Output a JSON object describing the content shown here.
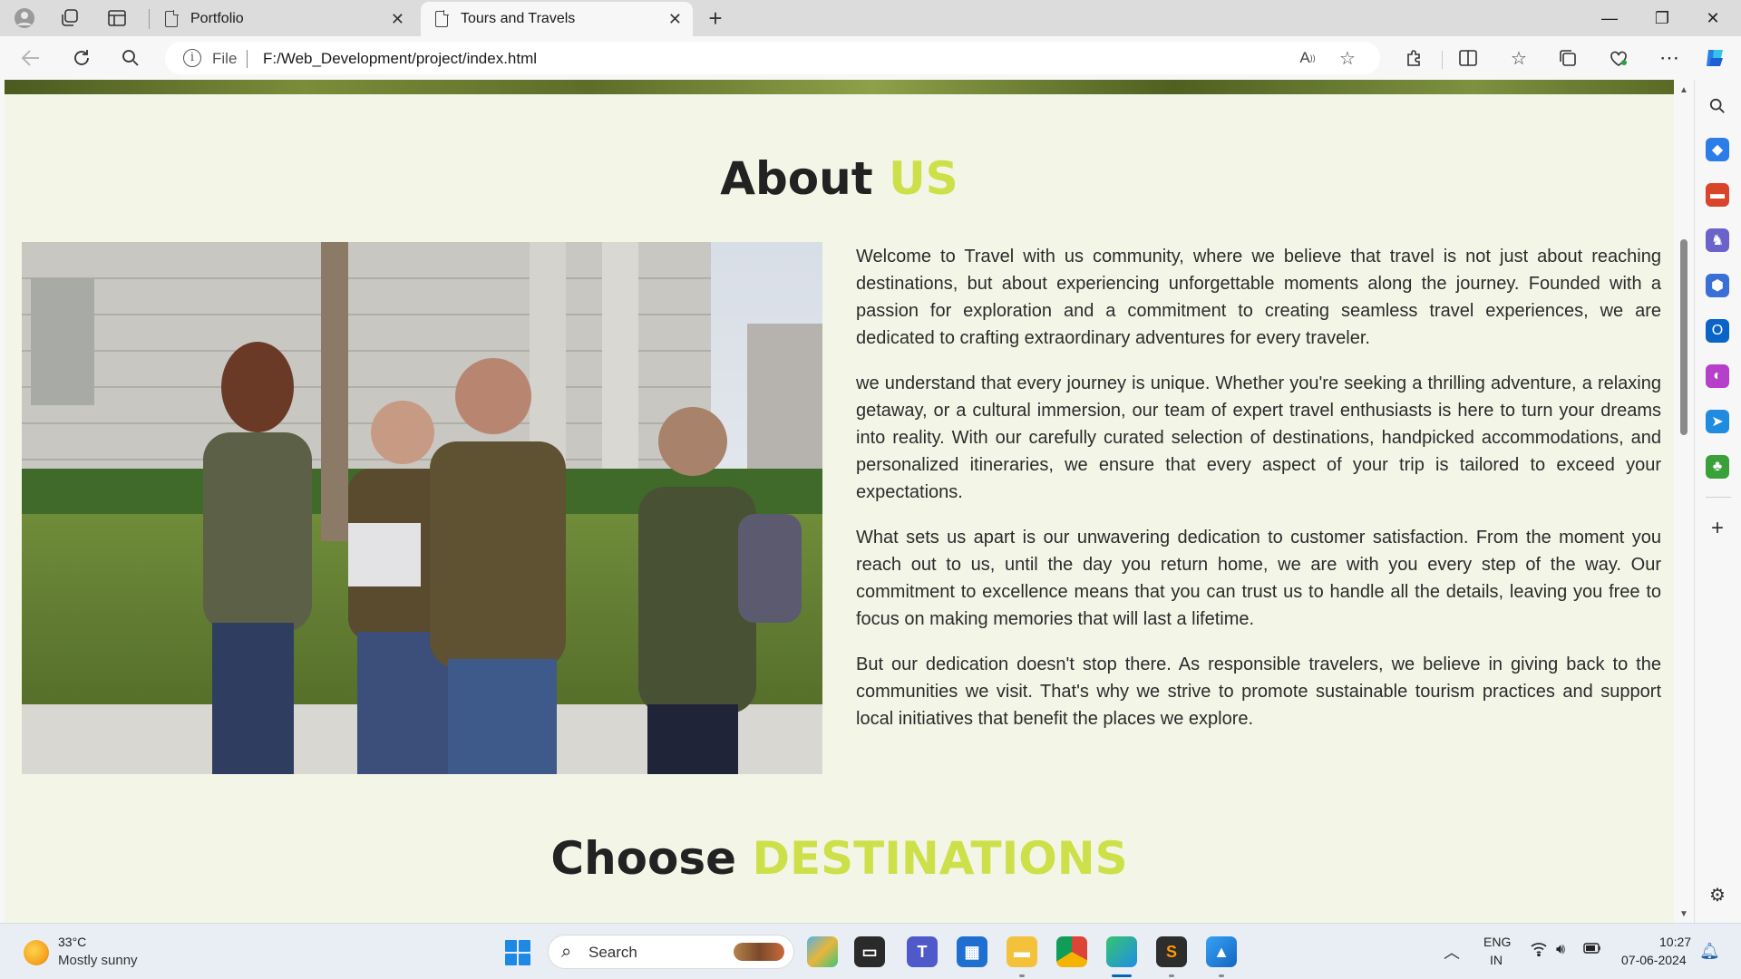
{
  "browser": {
    "tabs": [
      {
        "title": "Portfolio",
        "close": "✕"
      },
      {
        "title": "Tours and Travels",
        "close": "✕"
      }
    ],
    "new_tab": "+",
    "window_controls": {
      "minimize": "—",
      "restore": "❐",
      "close": "✕"
    },
    "address": {
      "scheme_label": "File",
      "url": "F:/Web_Development/project/index.html"
    }
  },
  "page": {
    "about_title": {
      "main": "About",
      "accent": "US"
    },
    "about_paragraphs": [
      "Welcome to Travel with us community, where we believe that travel is not just about reaching destinations, but about experiencing unforgettable moments along the journey. Founded with a passion for exploration and a commitment to creating seamless travel experiences, we are dedicated to crafting extraordinary adventures for every traveler.",
      "we understand that every journey is unique. Whether you're seeking a thrilling adventure, a relaxing getaway, or a cultural immersion, our team of expert travel enthusiasts is here to turn your dreams into reality. With our carefully curated selection of destinations, handpicked accommodations, and personalized itineraries, we ensure that every aspect of your trip is tailored to exceed your expectations.",
      "What sets us apart is our unwavering dedication to customer satisfaction. From the moment you reach out to us, until the day you return home, we are with you every step of the way. Our commitment to excellence means that you can trust us to handle all the details, leaving you free to focus on making memories that will last a lifetime.",
      "But our dedication doesn't stop there. As responsible travelers, we believe in giving back to the communities we visit. That's why we strive to promote sustainable tourism practices and support local initiatives that benefit the places we explore."
    ],
    "destinations_title": {
      "main": "Choose",
      "accent": "DESTINATIONS"
    },
    "colors": {
      "accent": "#cde04a",
      "background": "#f3f6e7",
      "text": "#222222"
    }
  },
  "taskbar": {
    "weather": {
      "temp": "33°C",
      "desc": "Mostly sunny"
    },
    "search_label": "Search",
    "lang_line1": "ENG",
    "lang_line2": "IN",
    "time": "10:27",
    "date": "07-06-2024"
  }
}
